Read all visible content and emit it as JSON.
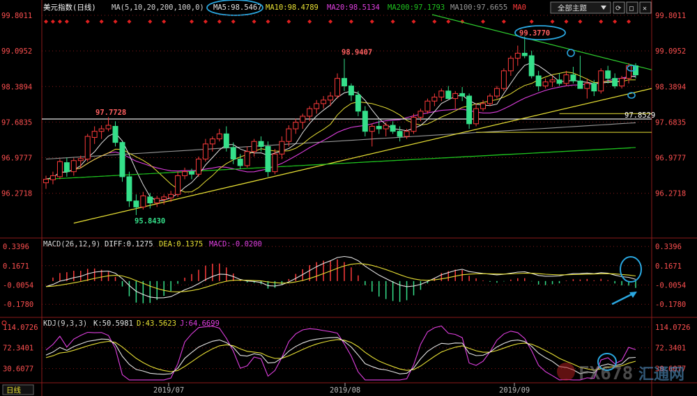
{
  "header": {
    "title": "美元指数(日线)",
    "ma_prefix": "MA(5,10,20,200,100,0)",
    "ma5": "MA5:98.5467",
    "ma10": "MA10:98.4789",
    "ma20": "MA20:98.5134",
    "ma200": "MA200:97.1793",
    "ma100": "MA100:97.6655",
    "ma0": "MA0",
    "dropdown": "全部主题"
  },
  "colors": {
    "up": "#ff3b3b",
    "down": "#35e08a",
    "ma5": "#e6e6e6",
    "ma10": "#e8e034",
    "ma20": "#e03fe0",
    "ma200": "#1fc41f",
    "ma100": "#9a9a9a",
    "trend": "#e8e034",
    "resist": "#2fd02f",
    "annot": "#2aa7e0",
    "grid": "#8b1a1a"
  },
  "chart_data": [
    {
      "type": "candlestick",
      "title": "美元指数(日线)",
      "y_ticks": [
        "99.8011",
        "99.0952",
        "98.3894",
        "97.6835",
        "96.9777",
        "96.2718"
      ],
      "ylim": [
        95.55,
        99.8011
      ],
      "annotations": [
        {
          "label": "97.7728",
          "kind": "high"
        },
        {
          "label": "95.8430",
          "kind": "low"
        },
        {
          "label": "98.9407",
          "kind": "high"
        },
        {
          "label": "99.3770",
          "kind": "high"
        },
        {
          "label": "97.8529",
          "kind": "level"
        }
      ],
      "horizontal_levels": [
        97.852,
        97.52,
        98.05
      ],
      "candles_ohlc": [
        [
          96.48,
          96.62,
          96.36,
          96.55
        ],
        [
          96.54,
          96.7,
          96.45,
          96.62
        ],
        [
          96.6,
          96.95,
          96.55,
          96.9
        ],
        [
          96.88,
          96.98,
          96.6,
          96.7
        ],
        [
          96.7,
          96.97,
          96.62,
          96.92
        ],
        [
          96.92,
          97.02,
          96.78,
          96.96
        ],
        [
          96.95,
          97.45,
          96.9,
          97.4
        ],
        [
          97.38,
          97.6,
          97.25,
          97.5
        ],
        [
          97.5,
          97.62,
          97.35,
          97.55
        ],
        [
          97.55,
          97.78,
          97.5,
          97.62
        ],
        [
          97.6,
          97.7,
          97.2,
          97.28
        ],
        [
          97.28,
          97.3,
          96.5,
          96.6
        ],
        [
          96.6,
          96.7,
          96.0,
          96.12
        ],
        [
          96.12,
          96.25,
          95.84,
          96.0
        ],
        [
          96.0,
          96.3,
          95.95,
          96.22
        ],
        [
          96.2,
          96.28,
          95.97,
          96.08
        ],
        [
          96.08,
          96.22,
          96.0,
          96.17
        ],
        [
          96.15,
          96.25,
          96.05,
          96.2
        ],
        [
          96.18,
          96.32,
          96.1,
          96.25
        ],
        [
          96.25,
          96.7,
          96.2,
          96.62
        ],
        [
          96.62,
          96.78,
          96.55,
          96.7
        ],
        [
          96.7,
          96.76,
          96.55,
          96.65
        ],
        [
          96.65,
          97.0,
          96.6,
          96.95
        ],
        [
          96.95,
          97.35,
          96.9,
          97.25
        ],
        [
          97.25,
          97.4,
          97.1,
          97.35
        ],
        [
          97.35,
          97.55,
          97.3,
          97.45
        ],
        [
          97.45,
          97.6,
          97.1,
          97.18
        ],
        [
          97.18,
          97.28,
          96.85,
          96.95
        ],
        [
          96.95,
          97.05,
          96.75,
          96.82
        ],
        [
          96.82,
          97.2,
          96.78,
          97.1
        ],
        [
          97.1,
          97.35,
          97.0,
          97.3
        ],
        [
          97.3,
          97.4,
          97.1,
          97.2
        ],
        [
          97.2,
          97.3,
          96.6,
          96.7
        ],
        [
          96.7,
          97.15,
          96.65,
          97.05
        ],
        [
          97.05,
          97.4,
          96.95,
          97.3
        ],
        [
          97.3,
          97.62,
          97.2,
          97.55
        ],
        [
          97.55,
          97.75,
          97.45,
          97.68
        ],
        [
          97.68,
          97.85,
          97.55,
          97.8
        ],
        [
          97.8,
          98.0,
          97.7,
          97.95
        ],
        [
          97.95,
          98.12,
          97.85,
          98.05
        ],
        [
          98.05,
          98.2,
          97.95,
          98.12
        ],
        [
          98.12,
          98.28,
          98.0,
          98.2
        ],
        [
          98.2,
          98.65,
          98.15,
          98.55
        ],
        [
          98.55,
          98.94,
          98.3,
          98.4
        ],
        [
          98.4,
          98.45,
          98.1,
          98.22
        ],
        [
          98.22,
          98.3,
          97.8,
          97.9
        ],
        [
          97.9,
          98.0,
          97.4,
          97.5
        ],
        [
          97.5,
          97.65,
          97.2,
          97.6
        ],
        [
          97.6,
          97.72,
          97.45,
          97.55
        ],
        [
          97.55,
          97.68,
          97.4,
          97.62
        ],
        [
          97.62,
          97.7,
          97.45,
          97.5
        ],
        [
          97.5,
          97.6,
          97.3,
          97.4
        ],
        [
          97.4,
          97.55,
          97.35,
          97.5
        ],
        [
          97.5,
          97.85,
          97.45,
          97.78
        ],
        [
          97.78,
          97.95,
          97.7,
          97.9
        ],
        [
          97.9,
          98.15,
          97.85,
          98.1
        ],
        [
          98.1,
          98.25,
          98.0,
          98.18
        ],
        [
          98.18,
          98.35,
          98.1,
          98.3
        ],
        [
          98.3,
          98.4,
          98.2,
          98.15
        ],
        [
          98.15,
          98.3,
          97.95,
          98.25
        ],
        [
          98.25,
          98.38,
          98.1,
          98.2
        ],
        [
          98.2,
          98.25,
          97.55,
          97.65
        ],
        [
          97.65,
          98.05,
          97.6,
          97.95
        ],
        [
          97.95,
          98.12,
          97.9,
          98.05
        ],
        [
          98.05,
          98.25,
          98.0,
          98.2
        ],
        [
          98.2,
          98.4,
          98.15,
          98.35
        ],
        [
          98.35,
          98.75,
          98.3,
          98.7
        ],
        [
          98.7,
          99.0,
          98.6,
          98.95
        ],
        [
          98.95,
          99.2,
          98.8,
          99.05
        ],
        [
          99.05,
          99.38,
          98.95,
          99.0
        ],
        [
          99.0,
          99.1,
          98.55,
          98.6
        ],
        [
          98.6,
          98.7,
          98.3,
          98.4
        ],
        [
          98.4,
          98.55,
          98.35,
          98.48
        ],
        [
          98.48,
          98.6,
          98.38,
          98.52
        ],
        [
          98.52,
          98.65,
          98.4,
          98.45
        ],
        [
          98.45,
          98.7,
          98.4,
          98.62
        ],
        [
          98.62,
          98.78,
          98.45,
          98.5
        ],
        [
          98.5,
          99.0,
          98.4,
          98.35
        ],
        [
          98.35,
          98.55,
          98.15,
          98.45
        ],
        [
          98.45,
          98.52,
          98.2,
          98.3
        ],
        [
          98.3,
          98.75,
          98.25,
          98.7
        ],
        [
          98.7,
          98.8,
          98.45,
          98.55
        ],
        [
          98.55,
          98.65,
          98.35,
          98.4
        ],
        [
          98.4,
          98.6,
          98.35,
          98.55
        ],
        [
          98.55,
          98.85,
          98.45,
          98.8
        ],
        [
          98.8,
          98.85,
          98.55,
          98.62
        ]
      ],
      "series": [
        {
          "name": "MA5"
        },
        {
          "name": "MA10"
        },
        {
          "name": "MA20"
        },
        {
          "name": "MA200"
        },
        {
          "name": "MA100"
        }
      ]
    },
    {
      "type": "macd",
      "label": "MACD(26,12,9)",
      "diff": "DIFF:0.1275",
      "dea": "DEA:0.1375",
      "macd": "MACD:-0.0200",
      "y_ticks": [
        "0.3396",
        "0.1671",
        "-0.0054",
        "-0.1780"
      ],
      "ylim": [
        -0.27,
        0.39
      ]
    },
    {
      "type": "kdj",
      "label": "KDJ(9,3,3)",
      "k": "K:50.5981",
      "d": "D:43.5623",
      "j": "J:64.6699",
      "y_ticks": [
        "114.0726",
        "72.3401",
        "30.6077"
      ],
      "ylim": [
        5,
        125
      ]
    }
  ],
  "x_axis": {
    "labels": [
      "2019/07",
      "2019/08",
      "2019/09"
    ],
    "positions": [
      0.242,
      0.495,
      0.738
    ]
  },
  "footer": {
    "period": "日线"
  },
  "watermark": {
    "text": "FX678",
    "cn": "汇通网"
  }
}
